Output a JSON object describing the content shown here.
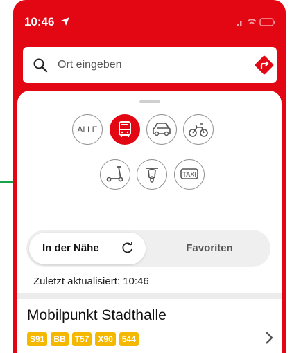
{
  "status_bar": {
    "time": "10:46"
  },
  "search": {
    "placeholder": "Ort eingeben"
  },
  "modes": {
    "alle": "ALLE",
    "taxi": "TAXI"
  },
  "segment": {
    "nearby": "In der Nähe",
    "favorites": "Favoriten"
  },
  "last_updated": "Zuletzt aktualisiert: 10:46",
  "station": {
    "name": "Mobilpunkt Stadthalle",
    "lines": [
      "S91",
      "BB",
      "T57",
      "X90",
      "544"
    ]
  },
  "colors": {
    "brand": "#e30613",
    "line_badge": "#f5b800"
  }
}
